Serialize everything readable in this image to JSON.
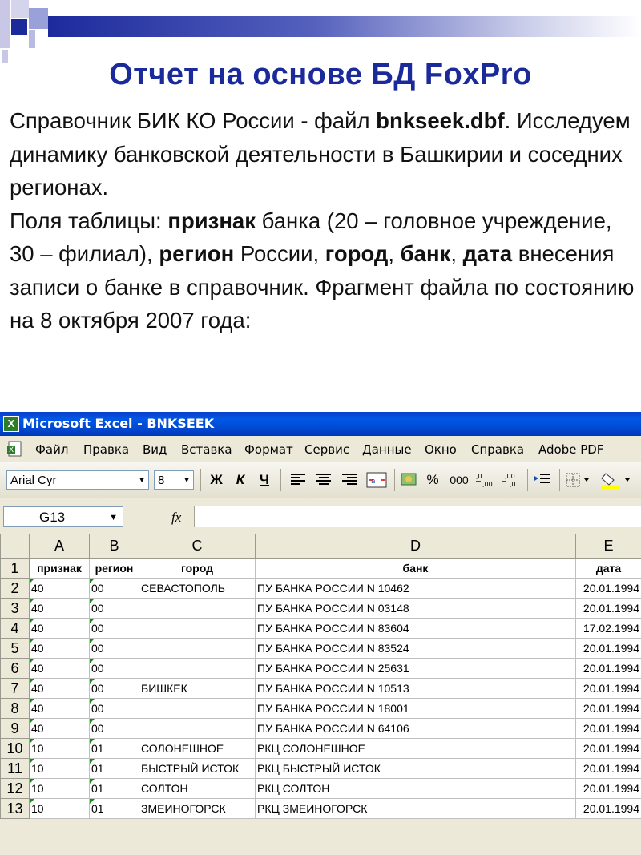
{
  "slide": {
    "title": "Отчет на основе БД FoxPro",
    "paragraph1": [
      {
        "text": "Справочник БИК КО России  - файл ",
        "bold": false
      },
      {
        "text": "bnkseek.dbf",
        "bold": true
      },
      {
        "text": ". Исследуем динамику банковской деятельности в Башкирии и соседних регионах.",
        "bold": false
      }
    ],
    "paragraph2": [
      {
        "text": "Поля таблицы: ",
        "bold": false
      },
      {
        "text": "признак",
        "bold": true
      },
      {
        "text": " банка (20 – головное учреждение, 30 – филиал), ",
        "bold": false
      },
      {
        "text": "регион",
        "bold": true
      },
      {
        "text": " России, ",
        "bold": false
      },
      {
        "text": "город",
        "bold": true
      },
      {
        "text": ", ",
        "bold": false
      },
      {
        "text": "банк",
        "bold": true
      },
      {
        "text": ", ",
        "bold": false
      },
      {
        "text": "дата",
        "bold": true
      },
      {
        "text": " внесения записи о банке в справочник. Фрагмент файла по состоянию на 8 октября 2007 года:",
        "bold": false
      }
    ]
  },
  "excel": {
    "window_title": "Microsoft Excel - BNKSEEK",
    "menu": [
      "Файл",
      "Правка",
      "Вид",
      "Вставка",
      "Формат",
      "Сервис",
      "Данные",
      "Окно",
      "Справка",
      "Adobe PDF"
    ],
    "toolbar": {
      "font": "Arial Cyr",
      "size": "8",
      "bold": "Ж",
      "italic": "К",
      "underline": "Ч",
      "percent": "%",
      "thousands": "000"
    },
    "name_box": "G13",
    "fx": "fx",
    "columns": [
      "A",
      "B",
      "C",
      "D",
      "E"
    ],
    "headers": [
      "признак",
      "регион",
      "город",
      "банк",
      "дата"
    ],
    "rows": [
      {
        "n": "2",
        "a": "40",
        "b": "00",
        "c": "СЕВАСТОПОЛЬ",
        "d": "ПУ БАНКА РОССИИ N 10462",
        "e": "20.01.1994"
      },
      {
        "n": "3",
        "a": "40",
        "b": "00",
        "c": "",
        "d": "ПУ БАНКА РОССИИ N 03148",
        "e": "20.01.1994"
      },
      {
        "n": "4",
        "a": "40",
        "b": "00",
        "c": "",
        "d": "ПУ БАНКА РОССИИ N 83604",
        "e": "17.02.1994"
      },
      {
        "n": "5",
        "a": "40",
        "b": "00",
        "c": "",
        "d": "ПУ БАНКА РОССИИ N 83524",
        "e": "20.01.1994"
      },
      {
        "n": "6",
        "a": "40",
        "b": "00",
        "c": "",
        "d": "ПУ БАНКА РОССИИ N 25631",
        "e": "20.01.1994"
      },
      {
        "n": "7",
        "a": "40",
        "b": "00",
        "c": "БИШКЕК",
        "d": "ПУ БАНКА РОССИИ N 10513",
        "e": "20.01.1994"
      },
      {
        "n": "8",
        "a": "40",
        "b": "00",
        "c": "",
        "d": "ПУ БАНКА РОССИИ N 18001",
        "e": "20.01.1994"
      },
      {
        "n": "9",
        "a": "40",
        "b": "00",
        "c": "",
        "d": "ПУ БАНКА РОССИИ N 64106",
        "e": "20.01.1994"
      },
      {
        "n": "10",
        "a": "10",
        "b": "01",
        "c": "СОЛОНЕШНОЕ",
        "d": "РКЦ СОЛОНЕШНОЕ",
        "e": "20.01.1994"
      },
      {
        "n": "11",
        "a": "10",
        "b": "01",
        "c": "БЫСТРЫЙ ИСТОК",
        "d": "РКЦ БЫСТРЫЙ ИСТОК",
        "e": "20.01.1994"
      },
      {
        "n": "12",
        "a": "10",
        "b": "01",
        "c": "СОЛТОН",
        "d": "РКЦ СОЛТОН",
        "e": "20.01.1994"
      },
      {
        "n": "13",
        "a": "10",
        "b": "01",
        "c": "ЗМЕИНОГОРСК",
        "d": "РКЦ ЗМЕИНОГОРСК",
        "e": "20.01.1994"
      }
    ],
    "colors": {
      "title_blue": "#1a2a9a",
      "titlebar": "#0054e3",
      "corner_mark": "#1a8a1a"
    }
  }
}
